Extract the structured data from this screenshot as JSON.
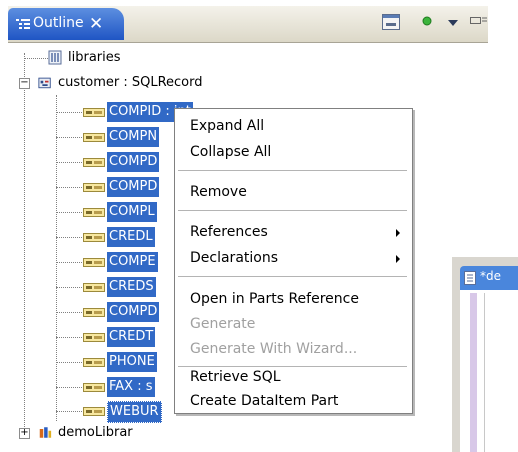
{
  "view": {
    "title": "Outline",
    "close_glyph": "✕",
    "toolbar": [
      {
        "name": "minimize-view-icon"
      },
      {
        "name": "green-dot-icon"
      },
      {
        "name": "view-menu-chevron-icon"
      },
      {
        "name": "more-views-icon"
      }
    ]
  },
  "tree": {
    "libraries": "libraries",
    "record": "customer : SQLRecord",
    "fields": [
      "COMPID : int",
      "COMPN",
      "COMPD",
      "COMPD",
      "COMPL",
      "CREDL",
      "COMPE",
      "CREDS",
      "COMPD",
      "CREDT",
      "PHONE",
      "FAX : s",
      "WEBUR"
    ],
    "last_item": "demoLibrar"
  },
  "editor": {
    "tab_label": "*de"
  },
  "context_menu": {
    "items": [
      {
        "label": "Expand All",
        "enabled": true,
        "submenu": false
      },
      {
        "label": "Collapse All",
        "enabled": true,
        "submenu": false
      },
      {
        "label": "Remove",
        "enabled": true,
        "submenu": false
      },
      {
        "label": "References",
        "enabled": true,
        "submenu": true
      },
      {
        "label": "Declarations",
        "enabled": true,
        "submenu": true
      },
      {
        "label": "Open in Parts Reference",
        "enabled": true,
        "submenu": false
      },
      {
        "label": "Generate",
        "enabled": false,
        "submenu": false
      },
      {
        "label": "Generate With Wizard...",
        "enabled": false,
        "submenu": false
      },
      {
        "label": "Retrieve SQL",
        "enabled": true,
        "submenu": false
      },
      {
        "label": "Create DataItem Part",
        "enabled": true,
        "submenu": false
      }
    ]
  },
  "colors": {
    "selection": "#3169c6",
    "tab_active": "#2a60cc",
    "menu_disabled": "#a0a0a0"
  }
}
